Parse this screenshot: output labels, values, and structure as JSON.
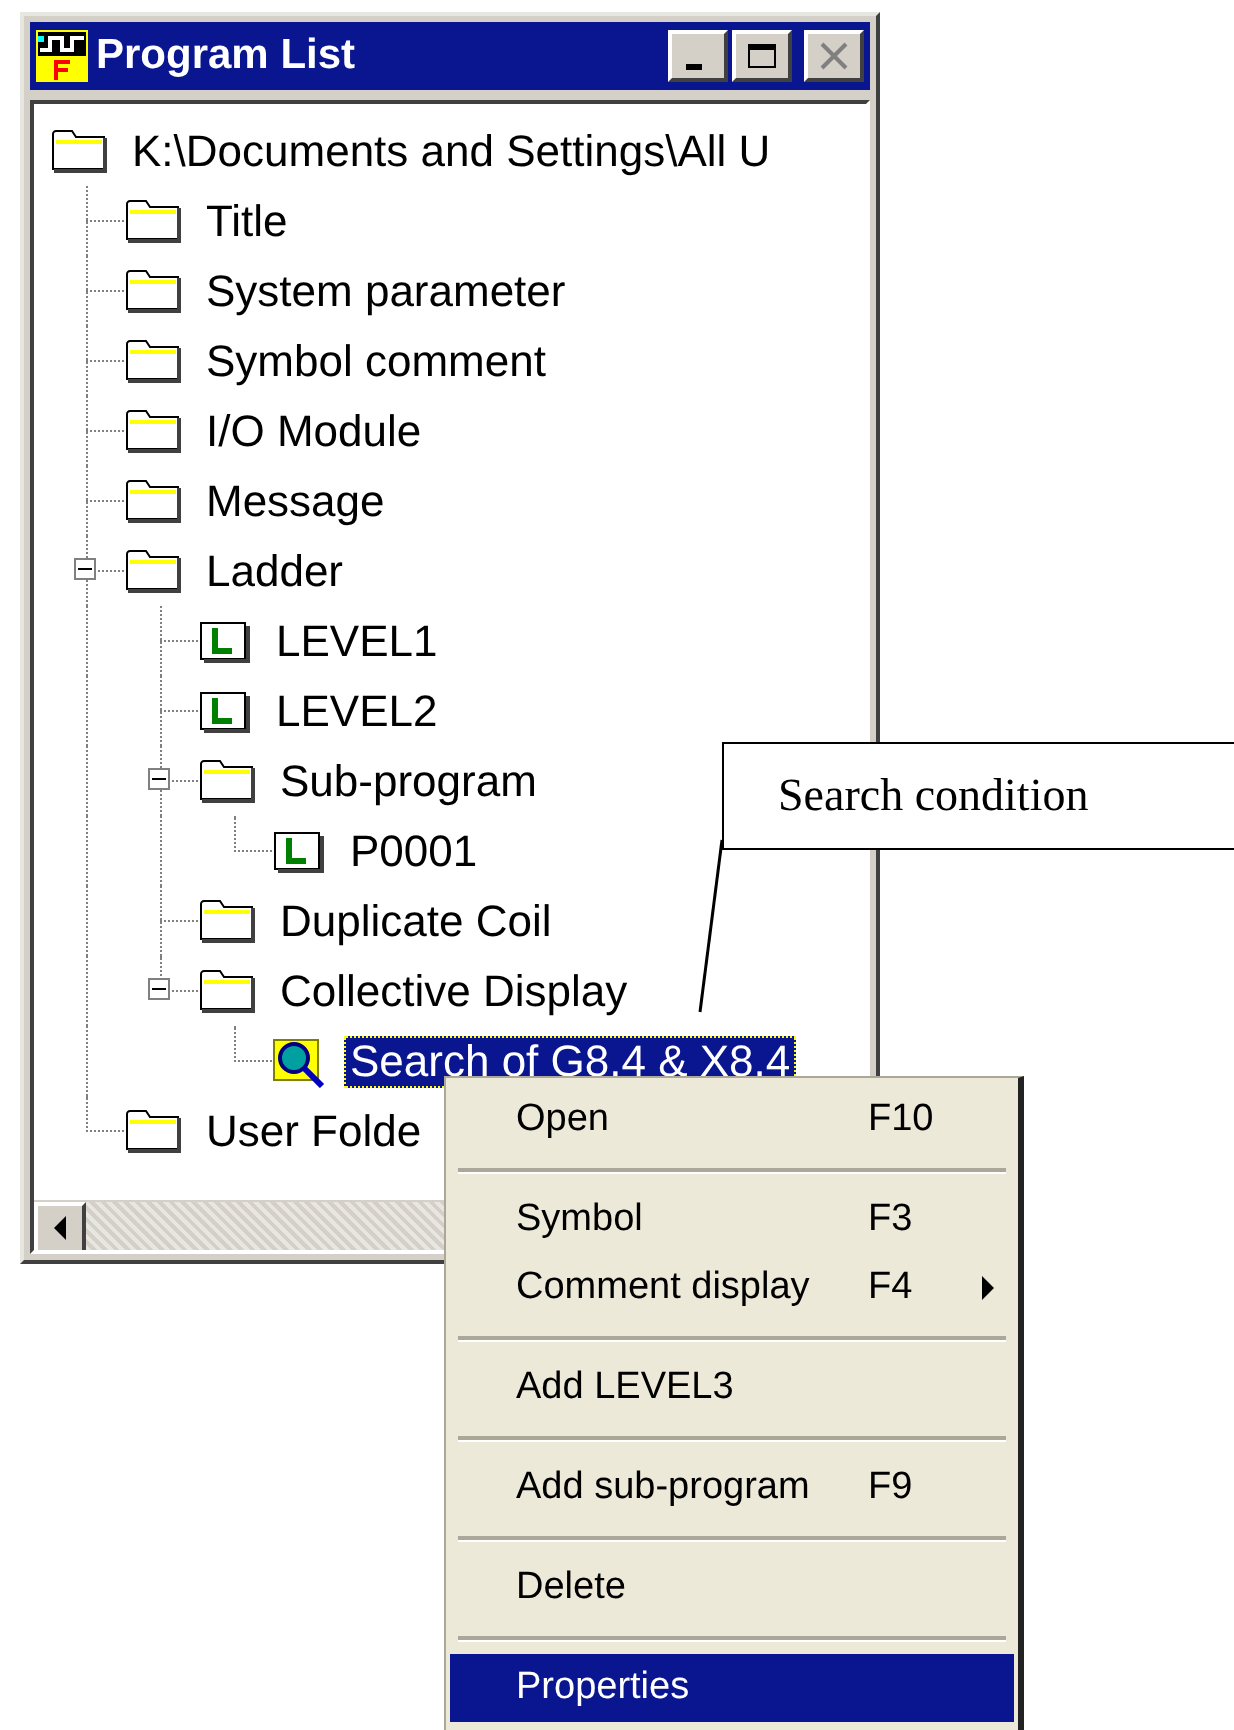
{
  "window": {
    "title": "Program List",
    "buttons": [
      {
        "kind": "minimize",
        "disabled": false
      },
      {
        "kind": "maximize",
        "disabled": false
      },
      {
        "kind": "close",
        "disabled": true
      }
    ]
  },
  "tree": {
    "items": [
      {
        "label": "K:\\Documents and Settings\\All U",
        "kind": "folder",
        "selected": false,
        "children": [
          {
            "label": "Title",
            "kind": "folder",
            "selected": false
          },
          {
            "label": "System parameter",
            "kind": "folder",
            "selected": false
          },
          {
            "label": "Symbol comment",
            "kind": "folder",
            "selected": false
          },
          {
            "label": "I/O Module",
            "kind": "folder",
            "selected": false
          },
          {
            "label": "Message",
            "kind": "folder",
            "selected": false
          },
          {
            "label": "Ladder",
            "kind": "folder",
            "selected": false,
            "expanded": true,
            "children": [
              {
                "label": "LEVEL1",
                "kind": "ladder",
                "selected": false
              },
              {
                "label": "LEVEL2",
                "kind": "ladder",
                "selected": false
              },
              {
                "label": "Sub-program",
                "kind": "folder",
                "selected": false,
                "expanded": true,
                "children": [
                  {
                    "label": "P0001",
                    "kind": "ladder",
                    "selected": false
                  }
                ]
              },
              {
                "label": "Duplicate Coil",
                "kind": "folder",
                "selected": false
              },
              {
                "label": "Collective Display",
                "kind": "folder",
                "selected": false,
                "expanded": true,
                "children": [
                  {
                    "label": "Search of G8.4 & X8.4",
                    "kind": "search",
                    "selected": true
                  }
                ]
              }
            ]
          },
          {
            "label": "User Folde",
            "kind": "folder",
            "selected": false
          }
        ]
      }
    ]
  },
  "context_menu": {
    "items": [
      {
        "kind": "item",
        "label": "Open",
        "shortcut": "F10",
        "selected": false
      },
      {
        "kind": "separator"
      },
      {
        "kind": "item",
        "label": "Symbol",
        "shortcut": "F3",
        "selected": false
      },
      {
        "kind": "item",
        "label": "Comment display",
        "shortcut": "F4",
        "submenu": true,
        "selected": false
      },
      {
        "kind": "separator"
      },
      {
        "kind": "item",
        "label": "Add LEVEL3",
        "selected": false
      },
      {
        "kind": "separator"
      },
      {
        "kind": "item",
        "label": "Add sub-program",
        "shortcut": "F9",
        "selected": false
      },
      {
        "kind": "separator"
      },
      {
        "kind": "item",
        "label": "Delete",
        "selected": false
      },
      {
        "kind": "separator"
      },
      {
        "kind": "item",
        "label": "Properties",
        "selected": true
      }
    ]
  },
  "callout": {
    "text": "Search condition"
  }
}
